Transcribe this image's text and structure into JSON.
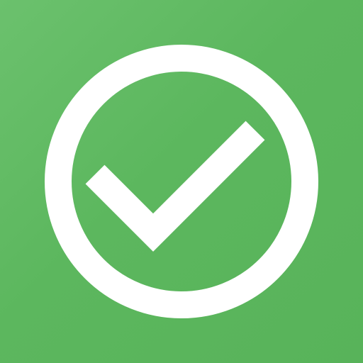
{
  "icon": {
    "name": "check-circle-icon",
    "background_color": "#5fb761",
    "foreground_color": "#ffffff"
  }
}
